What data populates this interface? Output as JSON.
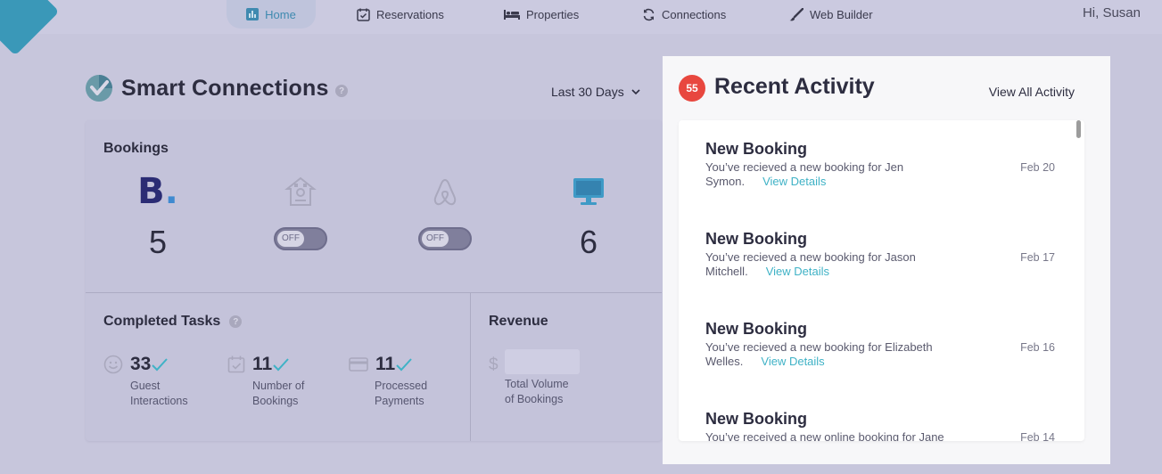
{
  "nav": {
    "items": [
      {
        "label": "Home",
        "icon": "bar-chart-icon"
      },
      {
        "label": "Reservations",
        "icon": "calendar-check-icon"
      },
      {
        "label": "Properties",
        "icon": "bed-icon"
      },
      {
        "label": "Connections",
        "icon": "sync-icon"
      },
      {
        "label": "Web Builder",
        "icon": "brush-icon"
      }
    ],
    "greeting": "Hi, Susan"
  },
  "smart": {
    "title": "Smart Connections",
    "help": "?",
    "date_range": "Last 30 Days"
  },
  "bookings": {
    "label": "Bookings",
    "channels": [
      {
        "name": "booking-com",
        "logo_text": "B",
        "logo_dot": ".",
        "count": "5"
      },
      {
        "name": "homeaway",
        "toggle": "OFF"
      },
      {
        "name": "airbnb",
        "toggle": "OFF"
      },
      {
        "name": "website",
        "count": "6"
      }
    ]
  },
  "tasks": {
    "label": "Completed Tasks",
    "help": "?",
    "items": [
      {
        "value": "33",
        "line1": "Guest",
        "line2": "Interactions"
      },
      {
        "value": "11",
        "line1": "Number of",
        "line2": "Bookings"
      },
      {
        "value": "11",
        "line1": "Processed",
        "line2": "Payments"
      }
    ]
  },
  "revenue": {
    "label": "Revenue",
    "currency": "$",
    "line1": "Total Volume",
    "line2": "of Bookings"
  },
  "activity": {
    "badge": "55",
    "title": "Recent Activity",
    "view_all": "View All Activity",
    "items": [
      {
        "title": "New Booking",
        "desc": "You’ve recieved a new booking for Jen Symon.",
        "link": "View Details",
        "date": "Feb 20"
      },
      {
        "title": "New Booking",
        "desc": "You’ve recieved a new booking for Jason Mitchell.",
        "link": "View Details",
        "date": "Feb 17"
      },
      {
        "title": "New Booking",
        "desc": "You’ve recieved a new booking for Elizabeth Welles.",
        "link": "View Details",
        "date": "Feb 16"
      },
      {
        "title": "New Booking",
        "desc": "You’ve received a new online booking for Jane",
        "link": "",
        "date": "Feb 14"
      }
    ]
  },
  "colors": {
    "accent": "#3fb2c6",
    "badge": "#e8473f",
    "overlay": "#c7c6dc"
  }
}
